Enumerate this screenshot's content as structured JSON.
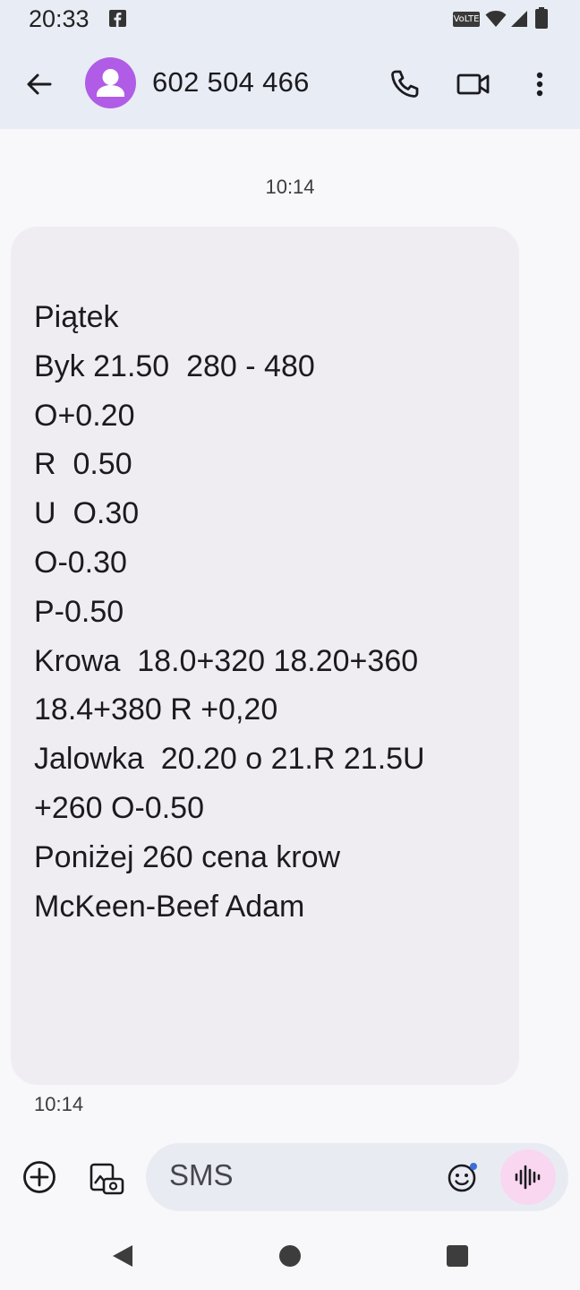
{
  "status_bar": {
    "time": "20:33",
    "volte_label": "VoLTE",
    "icons": [
      "facebook-icon",
      "volte-icon",
      "wifi-icon",
      "cell-signal-icon",
      "battery-icon"
    ]
  },
  "header": {
    "contact_name": "602 504 466",
    "icons": [
      "back-arrow-icon",
      "avatar-person-icon",
      "phone-call-icon",
      "video-call-icon",
      "more-vert-icon"
    ],
    "avatar_color": "#b05ce6"
  },
  "conversation": {
    "timestamp_top": "10:14",
    "message": {
      "lines": [
        "Piątek",
        "Byk 21.50  280 - 480",
        "O+0.20",
        "R  0.50",
        "U  O.30",
        "O-0.30",
        "P-0.50",
        "Krowa  18.0+320 18.20+360",
        "18.4+380 R +0,20",
        "Jalowka  20.20 o 21.R 21.5U",
        "+260 O-0.50",
        "Poniżej 260 cena krow",
        "McKeen-Beef Adam"
      ],
      "bubble_color": "#efedf2"
    },
    "timestamp_bottom": "10:14"
  },
  "compose": {
    "placeholder": "SMS",
    "icons": [
      "add-circle-icon",
      "gallery-icon",
      "emoji-icon",
      "voice-waveform-icon"
    ],
    "voice_button_color": "#f9d7f1"
  },
  "nav_bar": {
    "icons": [
      "nav-back-icon",
      "nav-home-icon",
      "nav-recents-icon"
    ]
  }
}
